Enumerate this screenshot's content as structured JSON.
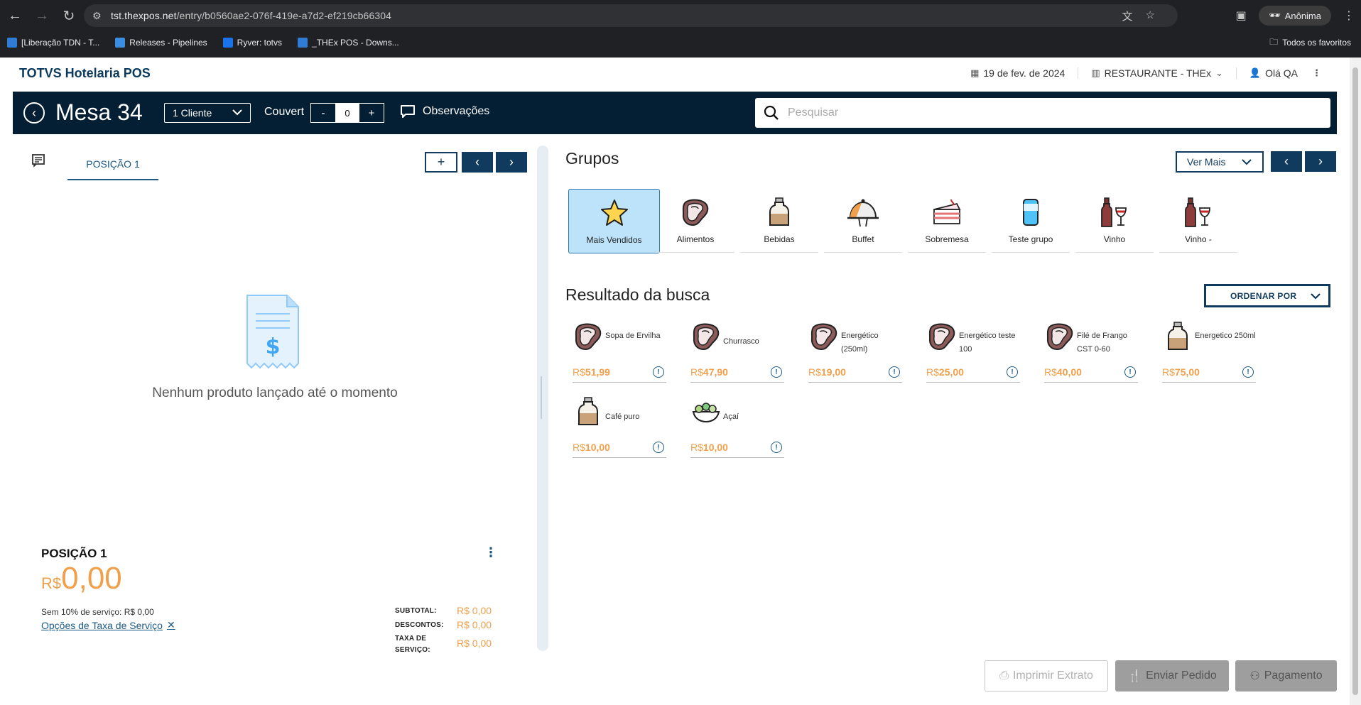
{
  "browser": {
    "url_host": "tst.thexpos.net",
    "url_path": "/entry/b0560ae2-076f-419e-a7d2-ef219cb66304",
    "profile_label": "Anônima",
    "bookmarks": [
      {
        "label": "[Liberação TDN - T...",
        "color": "#2e7cd6"
      },
      {
        "label": "Releases - Pipelines",
        "color": "#3a8de0"
      },
      {
        "label": "Ryver: totvs",
        "color": "#1a73e8"
      },
      {
        "label": "_THEx POS - Downs...",
        "color": "#2e7cd6"
      }
    ],
    "all_bookmarks_label": "Todos os favoritos"
  },
  "header": {
    "brand": "TOTVS Hotelaria POS",
    "date": "19 de fev. de 2024",
    "restaurant": "RESTAURANTE - THEx",
    "user": "Olá QA"
  },
  "bar": {
    "title": "Mesa 34",
    "client_select": "1 Cliente",
    "couvert_label": "Couvert",
    "couvert_minus": "-",
    "couvert_value": "0",
    "couvert_plus": "+",
    "observacoes": "Observações",
    "search_placeholder": "Pesquisar"
  },
  "left": {
    "tab_label": "POSIÇÃO 1",
    "add_label": "+",
    "empty_text": "Nenhum produto lançado até o momento",
    "position_title": "POSIÇÃO 1",
    "total_currency": "R$",
    "total_amount": "0,00",
    "service_text": "Sem 10% de serviço: R$ 0,00",
    "service_link": "Opções de Taxa de Serviço",
    "summary": {
      "subtotal_label": "SUBTOTAL:",
      "subtotal_value": "R$ 0,00",
      "descontos_label": "DESCONTOS:",
      "descontos_value": "R$ 0,00",
      "taxa_label_1": "TAXA DE",
      "taxa_label_2": "SERVIÇO:",
      "taxa_value": "R$ 0,00"
    }
  },
  "right": {
    "grupos_title": "Grupos",
    "ver_mais": "Ver Mais",
    "groups": [
      {
        "label": "Mais Vendidos",
        "icon": "star-icon",
        "active": true
      },
      {
        "label": "Alimentos",
        "icon": "steak-icon"
      },
      {
        "label": "Bebidas",
        "icon": "bottle-icon"
      },
      {
        "label": "Buffet",
        "icon": "cloche-icon"
      },
      {
        "label": "Sobremesa",
        "icon": "cake-icon"
      },
      {
        "label": "Teste grupo",
        "icon": "can-icon"
      },
      {
        "label": "Vinho",
        "icon": "wine-icon"
      },
      {
        "label": "Vinho -",
        "icon": "wine-icon"
      }
    ],
    "results_title": "Resultado da busca",
    "ordenar": "ORDENAR POR",
    "products": [
      {
        "name": "Sopa de Ervilha",
        "currency": "R$",
        "price": "51,99",
        "icon": "steak-icon"
      },
      {
        "name": "Churrasco",
        "currency": "R$",
        "price": "47,90",
        "icon": "steak-icon"
      },
      {
        "name": "Energético (250ml)",
        "currency": "R$",
        "price": "19,00",
        "icon": "steak-icon"
      },
      {
        "name": "Energético teste 100",
        "currency": "R$",
        "price": "25,00",
        "icon": "steak-icon"
      },
      {
        "name": "Filé de Frango CST 0-60",
        "currency": "R$",
        "price": "40,00",
        "icon": "steak-icon"
      },
      {
        "name": "Energetico 250ml",
        "currency": "R$",
        "price": "75,00",
        "icon": "bottle-icon"
      },
      {
        "name": "Café puro",
        "currency": "R$",
        "price": "10,00",
        "icon": "bottle-icon"
      },
      {
        "name": "Açaí",
        "currency": "R$",
        "price": "10,00",
        "icon": "salad-icon"
      }
    ]
  },
  "actions": {
    "print": "Imprimir Extrato",
    "send": "Enviar Pedido",
    "pay": "Pagamento"
  }
}
